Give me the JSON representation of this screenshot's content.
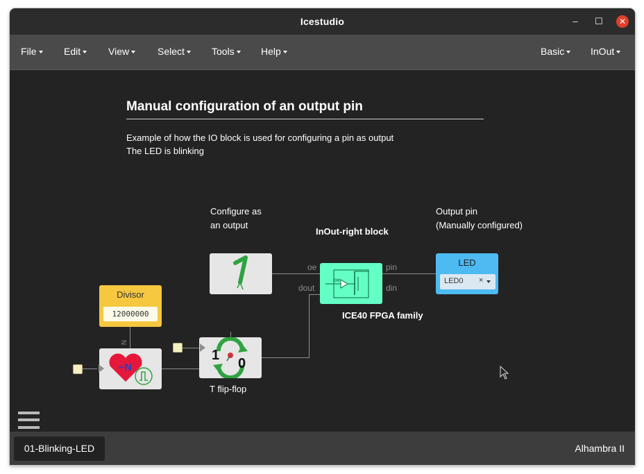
{
  "window": {
    "title": "Icestudio"
  },
  "menus": [
    {
      "label": "File"
    },
    {
      "label": "Edit"
    },
    {
      "label": "View"
    },
    {
      "label": "Select"
    },
    {
      "label": "Tools"
    },
    {
      "label": "Help"
    },
    {
      "label": "Basic"
    },
    {
      "label": "InOut"
    }
  ],
  "canvas": {
    "heading": "Manual configuration of an output pin",
    "description": [
      "Example of how the IO block is used for configuring a pin as output",
      "The LED is blinking"
    ],
    "labels": {
      "configure_line1": "Configure as",
      "configure_line2": "an output",
      "inout_block": "InOut-right block",
      "output_pin_line1": "Output pin",
      "output_pin_line2": "(Manually configured)",
      "ice40": "ICE40 FPGA family",
      "tflipflop": "T flip-flop"
    },
    "divisor": {
      "title": "Divisor",
      "value": "12000000"
    },
    "led": {
      "title": "LED",
      "pin": "LED0"
    },
    "ports": {
      "oe": "oe",
      "dout": "dout",
      "pin": "pin",
      "din": "din",
      "n": "N"
    },
    "icons": {
      "constant": "constant-one-icon",
      "inout": "inout-tristate-icon",
      "tff": "toggle-flipflop-icon",
      "divider": "heart-divider-icon"
    }
  },
  "statusbar": {
    "file_tab": "01-Blinking-LED",
    "board": "Alhambra II"
  }
}
